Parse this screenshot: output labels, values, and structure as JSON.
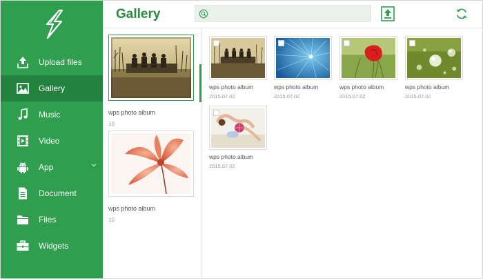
{
  "sidebar": {
    "items": [
      {
        "label": "Upload files",
        "icon": "upload-icon"
      },
      {
        "label": "Gallery",
        "icon": "gallery-icon",
        "active": true
      },
      {
        "label": "Music",
        "icon": "music-note-icon"
      },
      {
        "label": "Video",
        "icon": "film-icon"
      },
      {
        "label": "App",
        "icon": "android-icon"
      },
      {
        "label": "Document",
        "icon": "document-icon"
      },
      {
        "label": "Files",
        "icon": "folder-icon"
      },
      {
        "label": "Widgets",
        "icon": "toolbox-icon"
      }
    ]
  },
  "header": {
    "title": "Gallery",
    "search": {
      "value": "",
      "placeholder": ""
    }
  },
  "albums": [
    {
      "name": "wps photo album",
      "count": "10",
      "selected": true
    },
    {
      "name": "wps photo album",
      "count": "10",
      "selected": false
    }
  ],
  "photos": [
    {
      "name": "wps photo album",
      "date": "2015.07.02"
    },
    {
      "name": "wps photo album",
      "date": "2015.07.02"
    },
    {
      "name": "wps photo album",
      "date": "2015.07.02"
    },
    {
      "name": "wps photo album",
      "date": "2015.07.02"
    },
    {
      "name": "wps photo album",
      "date": "2015.07.02"
    }
  ],
  "colors": {
    "sidebar": "#2f9e4e",
    "sidebar_active": "#23823e",
    "accent": "#2a8a3f",
    "search_bg": "#e8f1ea"
  }
}
